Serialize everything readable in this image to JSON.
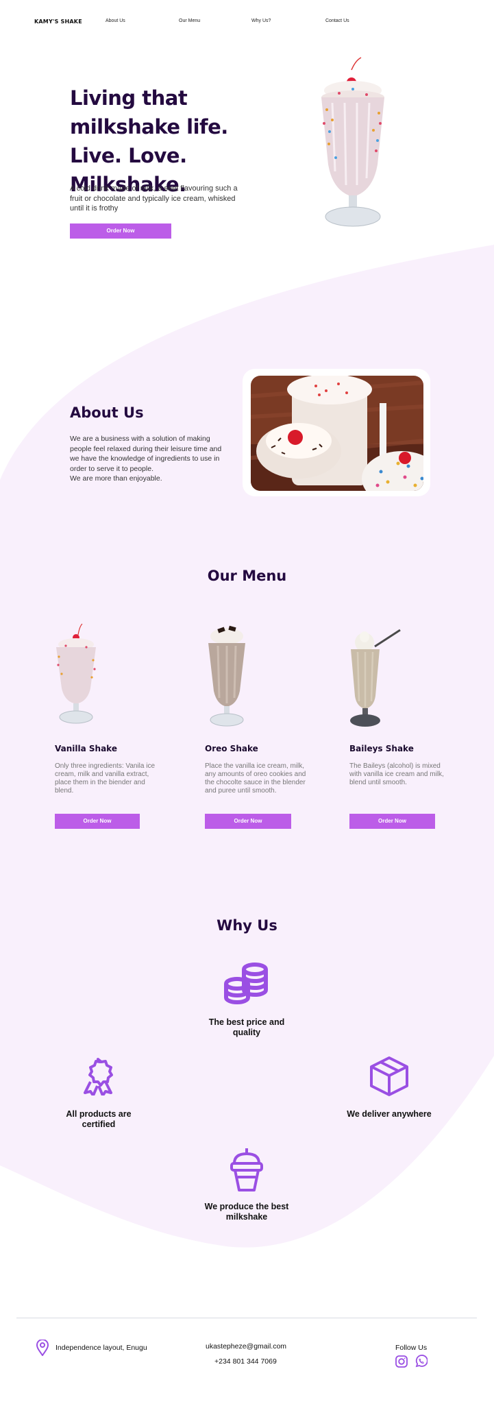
{
  "nav": {
    "logo": "KAMY'S SHAKE",
    "links": [
      "About Us",
      "Our Menu",
      "Why Us?",
      "Contact Us"
    ]
  },
  "hero": {
    "title": "Living that milkshake life. Live. Love. Milkshake.",
    "description": "A cold drink made of milk, a seet flavouring such a fruit or chocolate and typically ice cream, whisked until it is frothy",
    "cta": "Order Now"
  },
  "about": {
    "title": "About Us",
    "text": "We are a  business with a solution of making people feel relaxed during their leisure time and we have the knowledge of ingredients to use in order to serve it to people.\nWe are more than enjoyable."
  },
  "menu": {
    "title": "Our Menu",
    "items": [
      {
        "name": "Vanilla Shake",
        "description": "Only three ingredients: Vanila ice cream, milk and vanilla extract, place them in the biender and blend.",
        "cta": "Order Now"
      },
      {
        "name": "Oreo Shake",
        "description": "Place the vanilla ice cream, milk, any amounts of oreo cookies and the chocolte sauce in the blender and puree until smooth.",
        "cta": "Order Now"
      },
      {
        "name": "Baileys Shake",
        "description": "The Baileys (alcohol) is mixed with vanilla ice cream and milk, blend until smooth.",
        "cta": "Order Now"
      }
    ]
  },
  "why": {
    "title": "Why Us",
    "items": [
      {
        "label": "The best price and quality",
        "icon": "coins-icon"
      },
      {
        "label": "All products are certified",
        "icon": "award-ribbon-icon"
      },
      {
        "label": "We deliver anywhere",
        "icon": "box-icon"
      },
      {
        "label": "We produce the best milkshake",
        "icon": "milkshake-cup-icon"
      }
    ]
  },
  "footer": {
    "address": "Independence layout, Enugu",
    "email": "ukastepheze@gmail.com",
    "phone": "+234 801 344 7069",
    "follow": "Follow Us",
    "social": [
      "instagram-icon",
      "whatsapp-icon"
    ]
  },
  "colors": {
    "accent": "#bc5de8",
    "icon": "#9a4fe3",
    "heading": "#240a40",
    "blob": "#f9f0fc"
  }
}
